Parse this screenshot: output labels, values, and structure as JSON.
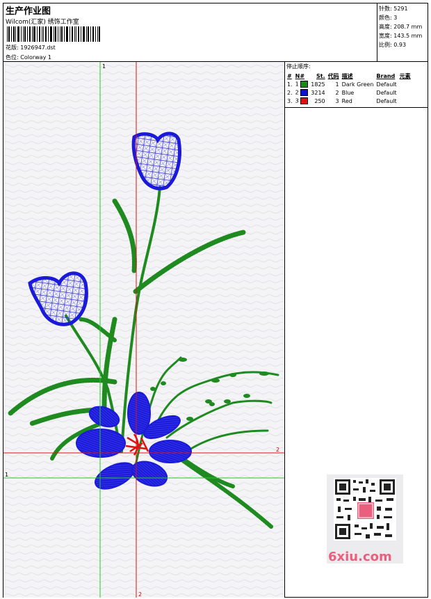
{
  "header": {
    "title": "生产作业图",
    "studio": "Wilcom(汇家) 绣饰工作室",
    "design_label": "花版:",
    "design_file": "1926947.dst",
    "colorway_label": "色位:",
    "colorway": "Colorway 1"
  },
  "stats": {
    "stitches": "针数: 5291",
    "colors": "颜色: 3",
    "height": "高度: 208.7 mm",
    "width": "宽度: 143.5 mm",
    "scale": "比例: 0.93"
  },
  "sequence": {
    "title": "停止顺序:",
    "headers": [
      "#",
      "N#",
      "St.",
      "代码",
      "描述",
      "Brand",
      "元素"
    ],
    "rows": [
      {
        "num": "1.",
        "n": "1",
        "color": "#1a8a1a",
        "stitches": "1825",
        "code": "1",
        "desc": "Dark Green",
        "brand": "Default"
      },
      {
        "num": "2.",
        "n": "2",
        "color": "#1010d0",
        "stitches": "3214",
        "code": "2",
        "desc": "Blue",
        "brand": "Default"
      },
      {
        "num": "3.",
        "n": "3",
        "color": "#e01010",
        "stitches": "250",
        "code": "3",
        "desc": "Red",
        "brand": "Default"
      }
    ]
  },
  "guides": {
    "green": "1",
    "red": "2"
  },
  "watermark": "6xiu.com"
}
